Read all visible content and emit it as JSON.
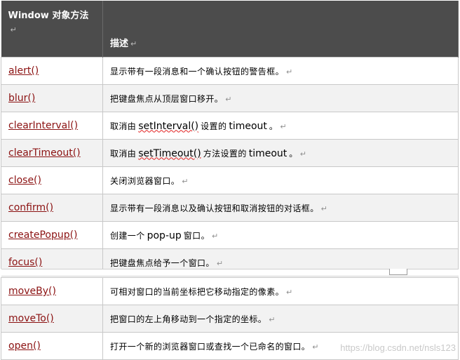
{
  "header": {
    "col1_title": "Window 对象方法",
    "col2_title": "描述"
  },
  "rows_top": [
    {
      "method": "alert()",
      "desc": [
        {
          "t": "显示带有一段消息和一个确认按钮的警告框。"
        }
      ]
    },
    {
      "method": "blur()",
      "desc": [
        {
          "t": "把键盘焦点从顶层窗口移开。"
        }
      ]
    },
    {
      "method": "clearInterval()",
      "desc": [
        {
          "t": "取消由"
        },
        {
          "t": "setInterval()",
          "en": true,
          "squiggle": true
        },
        {
          "t": "设置的"
        },
        {
          "t": "timeout",
          "en": true
        },
        {
          "t": "。"
        }
      ]
    },
    {
      "method": "clearTimeout()",
      "desc": [
        {
          "t": "取消由"
        },
        {
          "t": "setTimeout()",
          "en": true,
          "squiggle": true
        },
        {
          "t": "方法设置的"
        },
        {
          "t": "timeout",
          "en": true
        },
        {
          "t": "。"
        }
      ]
    },
    {
      "method": "close()",
      "desc": [
        {
          "t": "关闭浏览器窗口。"
        }
      ]
    },
    {
      "method": "confirm()",
      "desc": [
        {
          "t": "显示带有一段消息以及确认按钮和取消按钮的对话框。"
        }
      ]
    },
    {
      "method": "createPopup()",
      "desc": [
        {
          "t": "创建一个"
        },
        {
          "t": "pop-up",
          "en": true
        },
        {
          "t": "窗口。"
        }
      ]
    },
    {
      "method": "focus()",
      "desc": [
        {
          "t": "把键盘焦点给予一个窗口。"
        }
      ]
    }
  ],
  "rows_bottom": [
    {
      "method": "moveBy()",
      "desc": [
        {
          "t": "可相对窗口的当前坐标把它移动指定的像素。"
        }
      ]
    },
    {
      "method": "moveTo()",
      "desc": [
        {
          "t": "把窗口的左上角移动到一个指定的坐标。"
        }
      ]
    },
    {
      "method": "open()",
      "desc": [
        {
          "t": "打开一个新的浏览器窗口或查找一个已命名的窗口。"
        }
      ]
    }
  ],
  "paragraph_mark": "↵",
  "watermark": "https://blog.csdn.net/nsls123",
  "colors": {
    "header_bg": "#4c4c4c",
    "link": "#8b1111",
    "row_alt": "#f2f2f2",
    "border": "#c8c8c8"
  }
}
